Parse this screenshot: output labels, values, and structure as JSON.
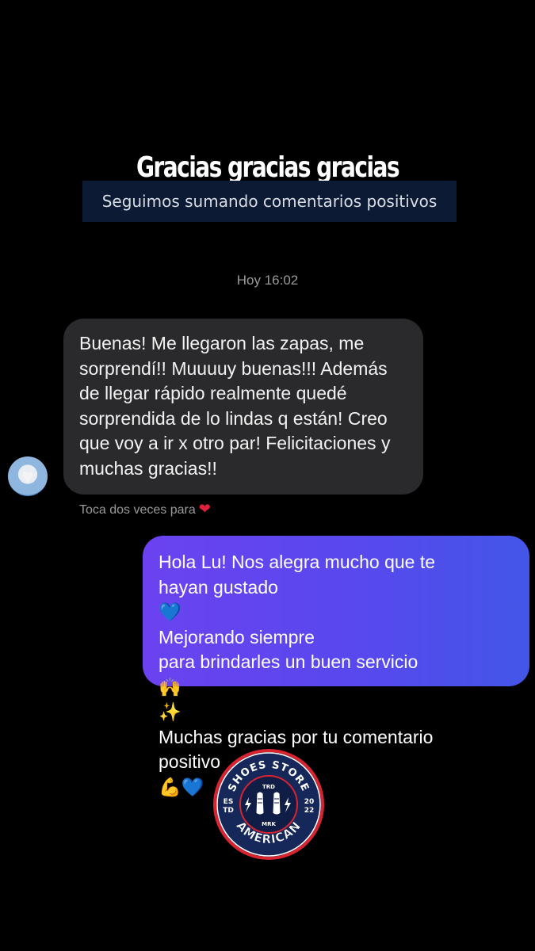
{
  "header": {
    "title": "Gracias gracias gracias",
    "subtitle": "Seguimos sumando comentarios positivos"
  },
  "chat": {
    "timestamp": "Hoy 16:02",
    "incoming": {
      "lines": [
        "Buenas! Me llegaron las zapas, me",
        "sorprendí!! Muuuuy buenas!!! Además",
        "de llegar rápido realmente quedé",
        "sorprendida de lo lindas q están! Creo",
        "que voy a ir x otro par! Felicitaciones y",
        "muchas gracias!!"
      ],
      "avatar_icon": "white-heart-icon"
    },
    "reaction_hint": "Toca dos veces para",
    "reaction_icon": "heart-icon",
    "outgoing": {
      "line1": "Hola Lu! Nos alegra mucho que te",
      "line2_text": "hayan gustado",
      "line2_emoji": "💙",
      "line2_rest": "Mejorando siempre",
      "line3_text": "para brindarles un buen servicio",
      "line3_emoji": "🙌",
      "line4_emoji": "✨",
      "line4_text": "Muchas gracias por tu comentario",
      "line5_text": "positivo",
      "line5_emoji": "💪💙"
    }
  },
  "logo": {
    "top_text": "SHOES STORE",
    "bottom_text": "AMERICAN",
    "left_text_1": "ES",
    "left_text_2": "TD",
    "right_text_1": "20",
    "right_text_2": "22",
    "inner_top": "TRD",
    "inner_bottom": "MRK"
  },
  "colors": {
    "background": "#000000",
    "incoming_bubble": "#2a2a2c",
    "outgoing_bubble_start": "#6b42f0",
    "outgoing_bubble_end": "#4356e8",
    "banner": "#0c1a33",
    "logo_red": "#d8242f",
    "logo_navy": "#16275a"
  }
}
